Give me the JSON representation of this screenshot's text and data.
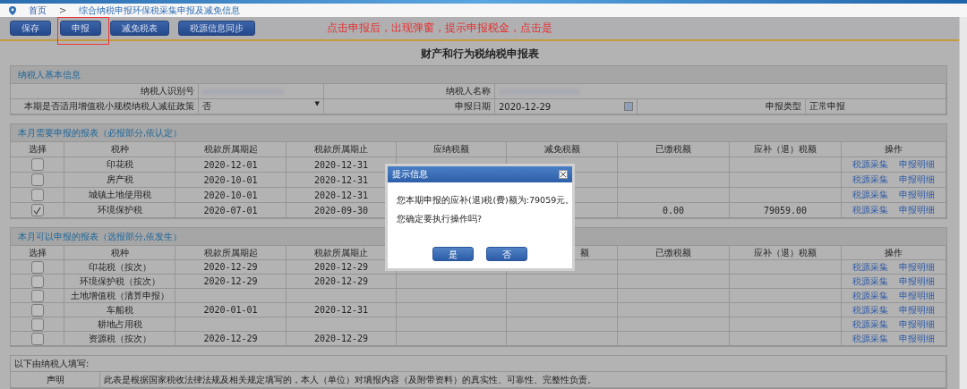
{
  "breadcrumb": {
    "home": "首页",
    "separator": ">",
    "current": "综合纳税申报环保税采集申报及减免信息"
  },
  "toolbar": {
    "buttons": [
      {
        "label": "保存",
        "highlighted": false
      },
      {
        "label": "申报",
        "highlighted": true
      },
      {
        "label": "减免税表",
        "highlighted": false
      },
      {
        "label": "税源信息同步",
        "highlighted": false
      }
    ],
    "annotation": "点击申报后，出现弹窗，提示申报税金，点击是"
  },
  "form_title": "财产和行为税纳税申报表",
  "basic_info": {
    "title": "纳税人基本信息",
    "taxpayer_id_label": "纳税人识别号",
    "taxpayer_name_label": "纳税人名称",
    "policy_label": "本期是否适用增值税小规模纳税人减征政策",
    "policy_value": "否",
    "policy_caret": "▼",
    "date_label": "申报日期",
    "date_value": "2020-12-29",
    "type_label": "申报类型",
    "type_value": "正常申报"
  },
  "required_section": {
    "title": "本月需要申报的报表（必报部分,依认定）",
    "columns": [
      "选择",
      "税种",
      "税款所属期起",
      "税款所属期止",
      "应纳税额",
      "减免税额",
      "已缴税额",
      "应补（退）税额",
      "操作"
    ],
    "rows": [
      {
        "checked": false,
        "tax": "印花税",
        "start": "2020-12-01",
        "end": "2020-12-31",
        "paid": "",
        "due": "",
        "actions": [
          "税源采集",
          "申报明细"
        ]
      },
      {
        "checked": false,
        "tax": "房产税",
        "start": "2020-10-01",
        "end": "2020-12-31",
        "paid": "",
        "due": "",
        "actions": [
          "税源采集",
          "申报明细"
        ]
      },
      {
        "checked": false,
        "tax": "城镇土地使用税",
        "start": "2020-10-01",
        "end": "2020-12-31",
        "paid": "",
        "due": "",
        "actions": [
          "税源采集",
          "申报明细"
        ]
      },
      {
        "checked": true,
        "tax": "环境保护税",
        "start": "2020-07-01",
        "end": "2020-09-30",
        "paid": "0.00",
        "due": "79059.00",
        "actions": [
          "税源采集",
          "申报明细"
        ]
      }
    ]
  },
  "optional_section": {
    "title": "本月可以申报的报表（选报部分,依发生）",
    "columns": [
      "选择",
      "税种",
      "税款所属期起",
      "税款所属期止",
      "额",
      "已缴税额",
      "应补（退）税额",
      "操作"
    ],
    "rows": [
      {
        "checked": false,
        "tax": "印花税（按次）",
        "start": "2020-12-29",
        "end": "2020-12-29",
        "paid": "",
        "due": "",
        "actions": [
          "税源采集",
          "申报明细"
        ]
      },
      {
        "checked": false,
        "tax": "环境保护税（按次）",
        "start": "2020-12-29",
        "end": "2020-12-29",
        "paid": "",
        "due": "",
        "actions": [
          "税源采集",
          "申报明细"
        ]
      },
      {
        "checked": false,
        "tax": "土地增值税（清算申报）",
        "start": "",
        "end": "",
        "paid": "",
        "due": "",
        "actions": [
          "税源采集",
          "申报明细"
        ]
      },
      {
        "checked": false,
        "tax": "车船税",
        "start": "2020-01-01",
        "end": "2020-12-31",
        "paid": "",
        "due": "",
        "actions": [
          "税源采集",
          "申报明细"
        ]
      },
      {
        "checked": false,
        "tax": "耕地占用税",
        "start": "",
        "end": "",
        "paid": "",
        "due": "",
        "actions": [
          "税源采集",
          "申报明细"
        ]
      },
      {
        "checked": false,
        "tax": "资源税（按次）",
        "start": "2020-12-29",
        "end": "2020-12-29",
        "paid": "",
        "due": "",
        "actions": [
          "税源采集",
          "申报明细"
        ]
      }
    ]
  },
  "declaration": {
    "intro": "以下由纳税人填写:",
    "label": "声明",
    "text": "此表是根据国家税收法律法规及相关规定填写的，本人（单位）对填报内容（及附带资料）的真实性、可靠性、完整性负责。"
  },
  "dialog": {
    "title": "提示信息",
    "message": "您本期申报的应补(退)税(费)额为:79059元。",
    "question": "您确定要执行操作吗?",
    "buttons": [
      "是",
      "否"
    ]
  }
}
